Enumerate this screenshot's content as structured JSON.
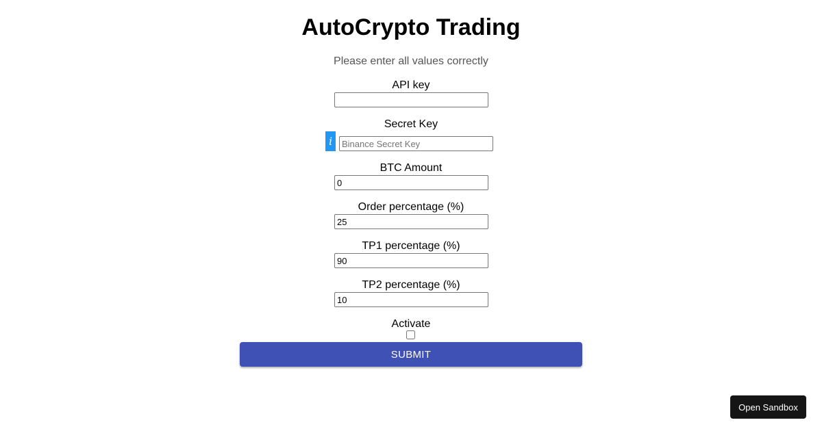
{
  "header": {
    "title": "AutoCrypto Trading",
    "subtitle": "Please enter all values correctly"
  },
  "form": {
    "api_key": {
      "label": "API key",
      "value": "",
      "placeholder": ""
    },
    "secret_key": {
      "label": "Secret Key",
      "value": "",
      "placeholder": "Binance Secret Key",
      "info_icon": "i"
    },
    "btc_amount": {
      "label": "BTC Amount",
      "value": "0"
    },
    "order_percentage": {
      "label": "Order percentage (%)",
      "value": "25"
    },
    "tp1_percentage": {
      "label": "TP1 percentage (%)",
      "value": "90"
    },
    "tp2_percentage": {
      "label": "TP2 percentage (%)",
      "value": "10"
    },
    "activate": {
      "label": "Activate",
      "checked": false
    },
    "submit_label": "Submit"
  },
  "sandbox": {
    "open_label": "Open Sandbox"
  },
  "colors": {
    "submit_background": "#3f51b5",
    "info_background": "#2196f3",
    "sandbox_background": "#151515"
  }
}
